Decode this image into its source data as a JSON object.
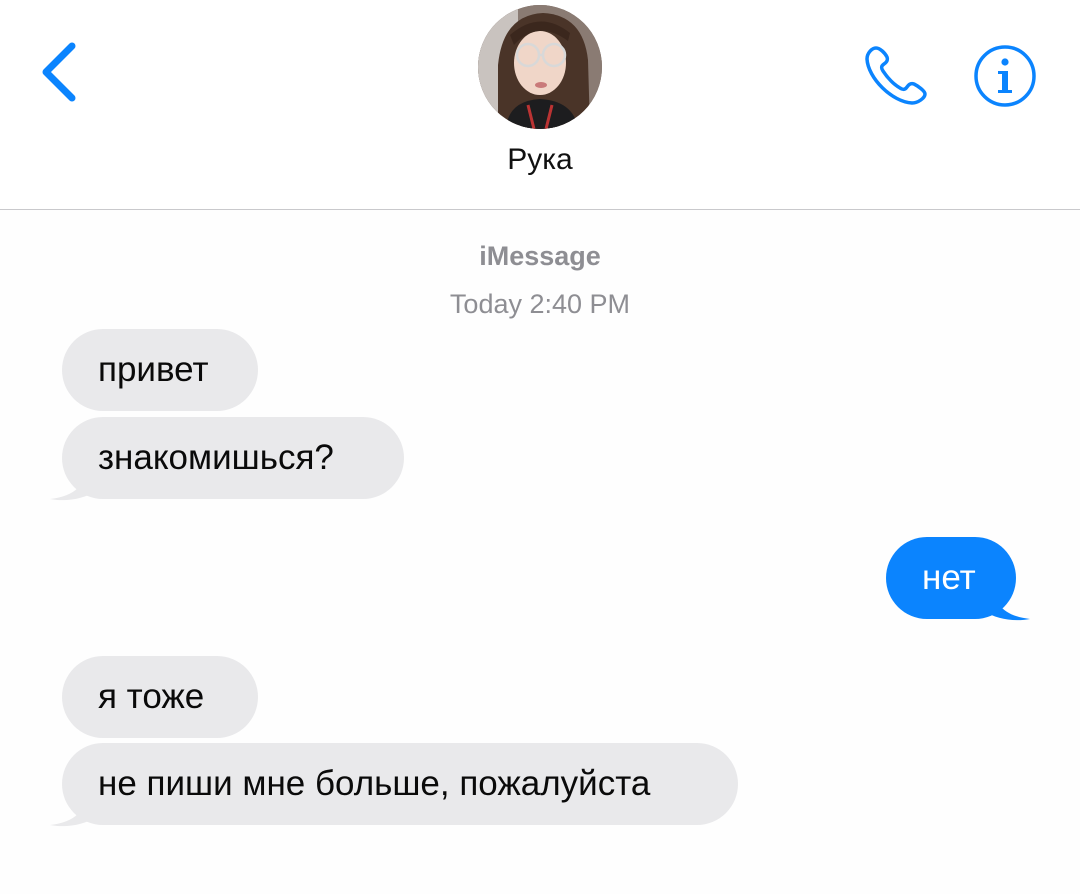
{
  "header": {
    "contact_name": "Рука",
    "back_icon": "chevron-left-icon",
    "call_icon": "phone-icon",
    "info_icon": "info-icon"
  },
  "conversation": {
    "service_label": "iMessage",
    "timestamp_day": "Today",
    "timestamp_time": "2:40 PM",
    "messages": [
      {
        "direction": "incoming",
        "text": "привет"
      },
      {
        "direction": "incoming",
        "text": "знакомишься?"
      },
      {
        "direction": "outgoing",
        "text": "нет"
      },
      {
        "direction": "incoming",
        "text": "я тоже"
      },
      {
        "direction": "incoming",
        "text": "не пиши мне больше, пожалуйста"
      }
    ]
  },
  "colors": {
    "accent": "#0b84fe",
    "incoming_bubble": "#e9e9eb",
    "meta_text": "#8e8e93"
  }
}
